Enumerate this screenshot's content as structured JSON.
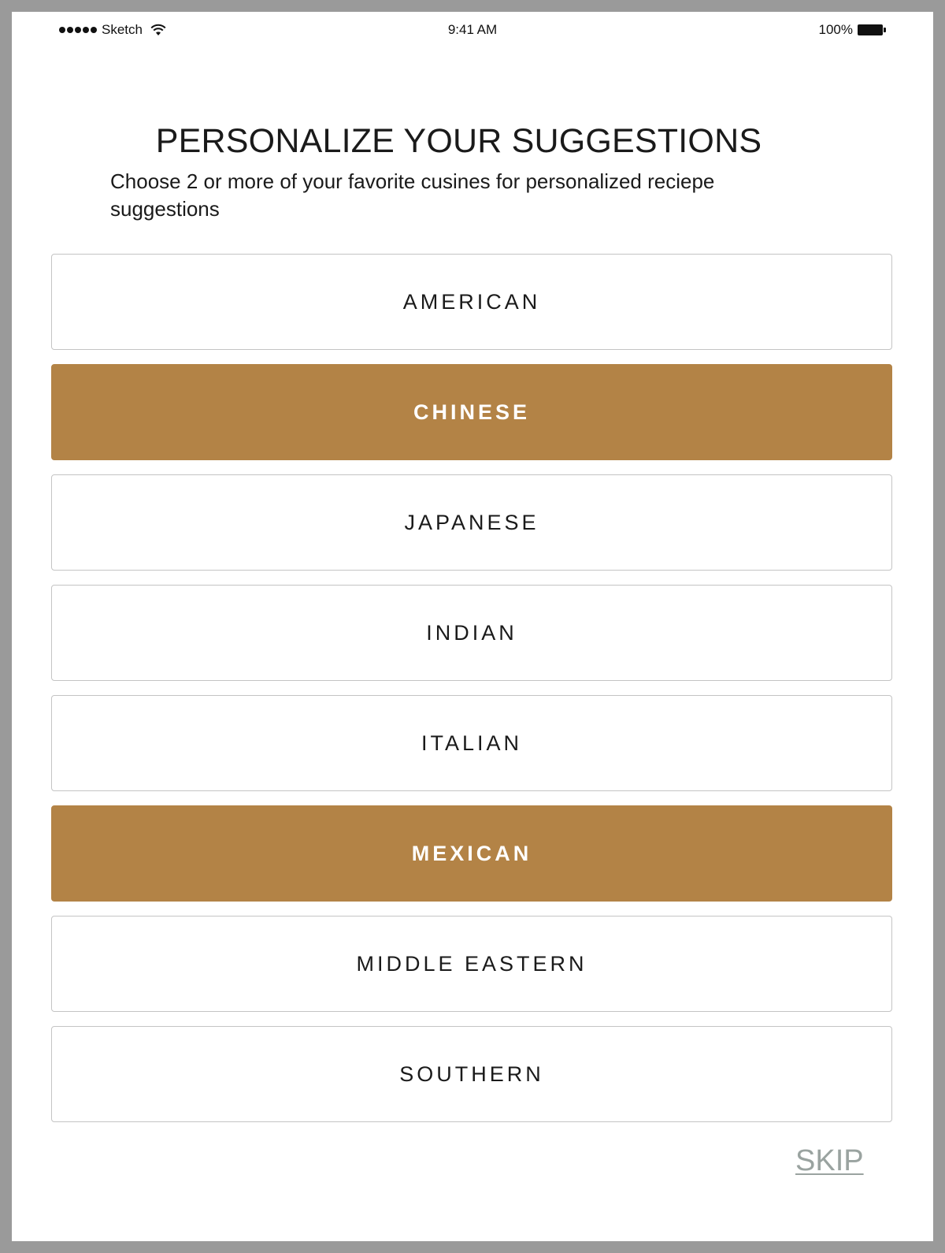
{
  "status_bar": {
    "carrier": "Sketch",
    "time": "9:41 AM",
    "battery_percent": "100%",
    "signal_icon": "signal-dots-icon",
    "wifi_icon": "wifi-icon",
    "battery_icon": "battery-icon"
  },
  "header": {
    "title": "PERSONALIZE YOUR SUGGESTIONS",
    "subtitle": "Choose 2 or more of your favorite cusines for personalized reciepe suggestions"
  },
  "cuisines": [
    {
      "label": "AMERICAN",
      "selected": false
    },
    {
      "label": "CHINESE",
      "selected": true
    },
    {
      "label": "JAPANESE",
      "selected": false
    },
    {
      "label": "INDIAN",
      "selected": false
    },
    {
      "label": "ITALIAN",
      "selected": false
    },
    {
      "label": "MEXICAN",
      "selected": true
    },
    {
      "label": "MIDDLE EASTERN",
      "selected": false
    },
    {
      "label": "SOUTHERN",
      "selected": false
    }
  ],
  "skip_label": "SKIP",
  "colors": {
    "selected_background": "#b38346",
    "skip_text": "#9aa3a0"
  }
}
